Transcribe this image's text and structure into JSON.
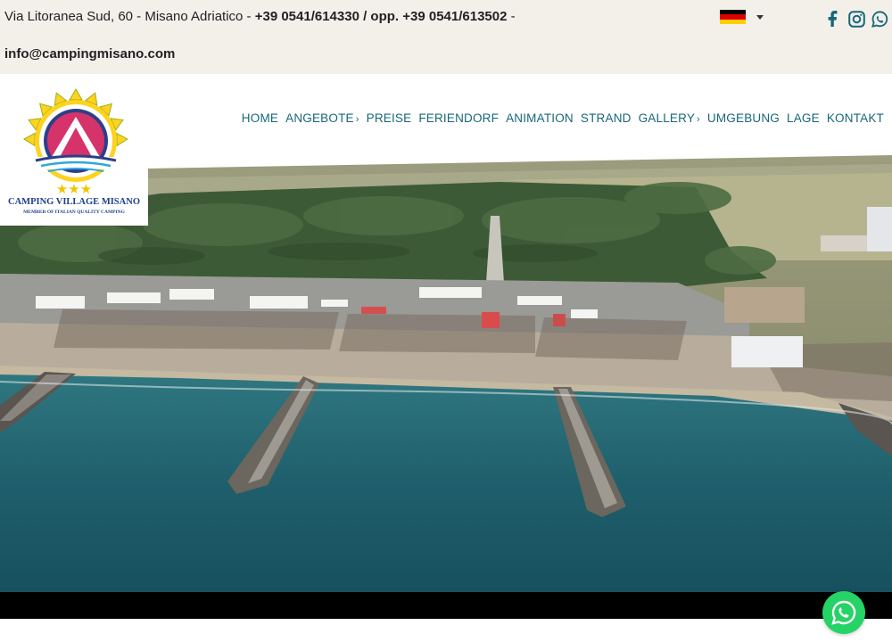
{
  "topbar": {
    "address": "Via Litoranea Sud, 60 - Misano Adriatico - ",
    "phone": "+39 0541/614330 / opp. +39 0541/613502",
    "phone_suffix": " -",
    "email": "info@campingmisano.com",
    "language_icon": "german-flag-icon",
    "social": [
      "facebook-icon",
      "instagram-icon",
      "whatsapp-icon"
    ]
  },
  "logo": {
    "name": "CAMPING VILLAGE MISANO",
    "tagline": "MEMBER OF ITALIAN QUALITY CAMPING",
    "stars": "★★★"
  },
  "nav": {
    "items": [
      {
        "label": "HOME",
        "submenu": false
      },
      {
        "label": "ANGEBOTE",
        "submenu": true
      },
      {
        "label": "PREISE",
        "submenu": false
      },
      {
        "label": "FERIENDORF",
        "submenu": false
      },
      {
        "label": "ANIMATION",
        "submenu": false
      },
      {
        "label": "STRAND",
        "submenu": false
      },
      {
        "label": "GALLERY",
        "submenu": true
      },
      {
        "label": "UMGEBUNG",
        "submenu": false
      },
      {
        "label": "LAGE",
        "submenu": false
      },
      {
        "label": "KONTAKT",
        "submenu": false
      }
    ],
    "submenu_glyph": "›"
  },
  "hero": {
    "image": "aerial-beach-camping-photo"
  },
  "colors": {
    "nav": "#17677a",
    "topbar_bg": "#f3f0ea",
    "whatsapp": "#25d366",
    "logo_text": "#1e3f8a"
  }
}
